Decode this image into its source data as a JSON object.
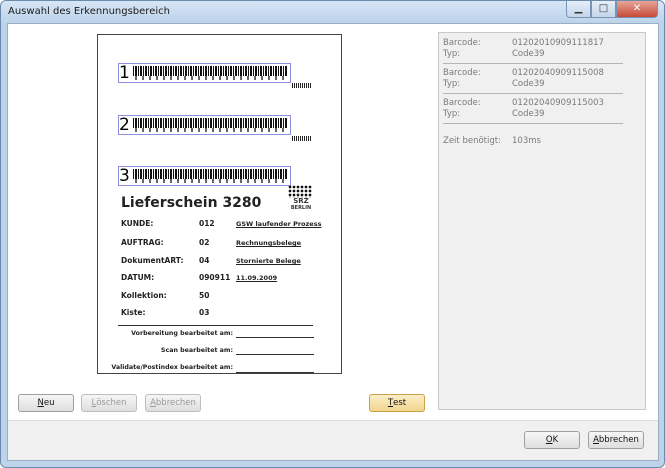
{
  "window": {
    "title": "Auswahl des Erkennungsbereich"
  },
  "document": {
    "zones": [
      {
        "number": "1"
      },
      {
        "number": "2"
      },
      {
        "number": "3"
      }
    ],
    "heading": "Lieferschein 3280",
    "logo_text": "SRZ",
    "logo_subtext": "BERLIN",
    "rows": [
      {
        "label": "KUNDE:",
        "value": "012",
        "link": "GSW laufender Prozess"
      },
      {
        "label": "AUFTRAG:",
        "value": "02",
        "link": "Rechnungsbelege"
      },
      {
        "label": "DokumentART:",
        "value": "04",
        "link": "Stornierte Belege"
      },
      {
        "label": "DATUM:",
        "value": "090911",
        "link": "11.09.2009"
      },
      {
        "label": "Kollektion:",
        "value": "50",
        "link": ""
      },
      {
        "label": "Kiste:",
        "value": "03",
        "link": ""
      }
    ],
    "signatures": [
      "Vorbereitung bearbeitet am:",
      "Scan bearbeitet am:",
      "Validate/Postindex bearbeitet am:"
    ]
  },
  "results": {
    "barcode_label": "Barcode:",
    "type_label": "Typ:",
    "entries": [
      {
        "barcode": "01202010909111817",
        "type": "Code39"
      },
      {
        "barcode": "01202040909115008",
        "type": "Code39"
      },
      {
        "barcode": "01202040909115003",
        "type": "Code39"
      }
    ],
    "time_label": "Zeit benötigt:",
    "time_value": "103ms"
  },
  "buttons": {
    "new": {
      "mnemonic": "N",
      "rest": "eu"
    },
    "delete": {
      "mnemonic": "L",
      "rest": "öschen"
    },
    "cancel_left": {
      "mnemonic": "A",
      "rest": "bbrechen"
    },
    "test": {
      "mnemonic": "T",
      "rest": "est"
    },
    "ok": {
      "mnemonic": "O",
      "rest": "K"
    },
    "cancel": {
      "mnemonic": "A",
      "rest": "bbrechen"
    }
  },
  "colors": {
    "zone_border": "#8f8fe0",
    "test_button": "#f2d58e",
    "window_frame": "#bcd3ea"
  }
}
